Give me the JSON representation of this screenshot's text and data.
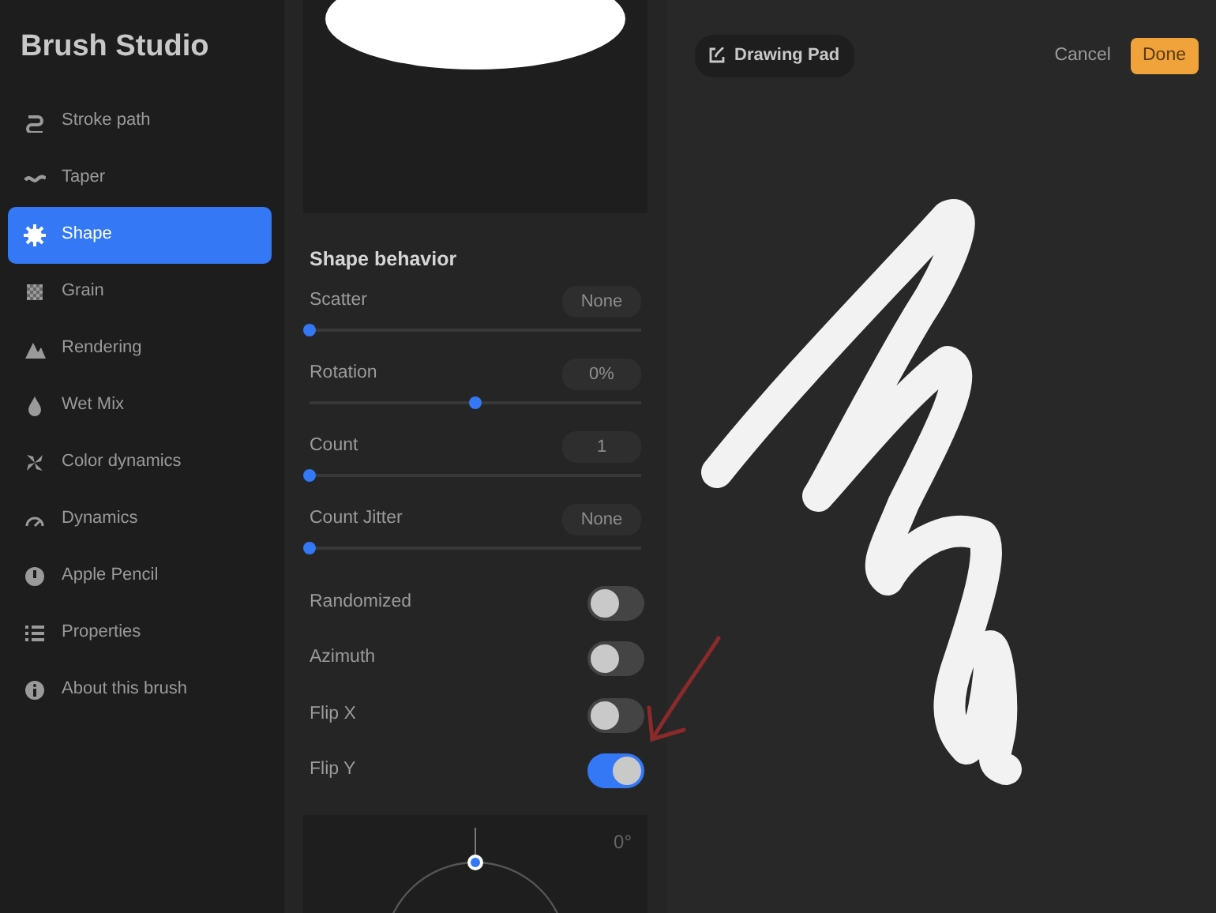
{
  "sidebar": {
    "title": "Brush Studio",
    "items": [
      {
        "label": "Stroke path",
        "selected": false
      },
      {
        "label": "Taper",
        "selected": false
      },
      {
        "label": "Shape",
        "selected": true
      },
      {
        "label": "Grain",
        "selected": false
      },
      {
        "label": "Rendering",
        "selected": false
      },
      {
        "label": "Wet Mix",
        "selected": false
      },
      {
        "label": "Color dynamics",
        "selected": false
      },
      {
        "label": "Dynamics",
        "selected": false
      },
      {
        "label": "Apple Pencil",
        "selected": false
      },
      {
        "label": "Properties",
        "selected": false
      },
      {
        "label": "About this brush",
        "selected": false
      }
    ]
  },
  "settings": {
    "section_title": "Shape behavior",
    "controls": [
      {
        "kind": "slider",
        "label": "Scatter",
        "value": "None",
        "level": 0
      },
      {
        "kind": "slider",
        "label": "Rotation",
        "value": "0%",
        "level": 0.5
      },
      {
        "kind": "slider",
        "label": "Count",
        "value": "1",
        "level": 0
      },
      {
        "kind": "slider",
        "label": "Count Jitter",
        "value": "None",
        "level": 0
      },
      {
        "kind": "toggle",
        "label": "Randomized",
        "on": false
      },
      {
        "kind": "toggle",
        "label": "Azimuth",
        "on": false
      },
      {
        "kind": "toggle",
        "label": "Flip X",
        "on": false
      },
      {
        "kind": "toggle",
        "label": "Flip Y",
        "on": true
      }
    ],
    "angle_readout": "0°"
  },
  "canvas": {
    "pad_label": "Drawing Pad",
    "cancel": "Cancel",
    "done": "Done"
  }
}
